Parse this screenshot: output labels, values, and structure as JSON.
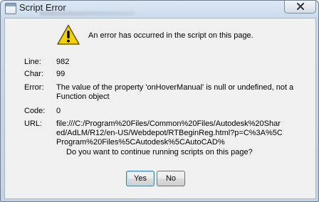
{
  "window": {
    "title": "Script Error"
  },
  "message": {
    "headline": "An error has occurred in the script on this page."
  },
  "details": {
    "line_label": "Line:",
    "line_value": "982",
    "char_label": "Char:",
    "char_value": "99",
    "error_label": "Error:",
    "error_value": "The value of the property 'onHoverManual' is null or undefined, not a Function object",
    "code_label": "Code:",
    "code_value": "0",
    "url_label": "URL:",
    "url_value": "file:///C:/Program%20Files/Common%20Files/Autodesk%20Shared/AdLM/R12/en-US/Webdepot/RTBeginReg.html?p=C%3A%5CProgram%20Files%5CAutodesk%5CAutoCAD%"
  },
  "prompt": {
    "question": "Do you want to continue running scripts on this page?"
  },
  "buttons": {
    "yes_label": "Yes",
    "no_label": "No"
  },
  "icons": {
    "warning": "warning-icon",
    "close": "close-icon",
    "app": "app-icon"
  },
  "colors": {
    "warning_yellow": "#f5d000",
    "close_x": "#333333"
  }
}
